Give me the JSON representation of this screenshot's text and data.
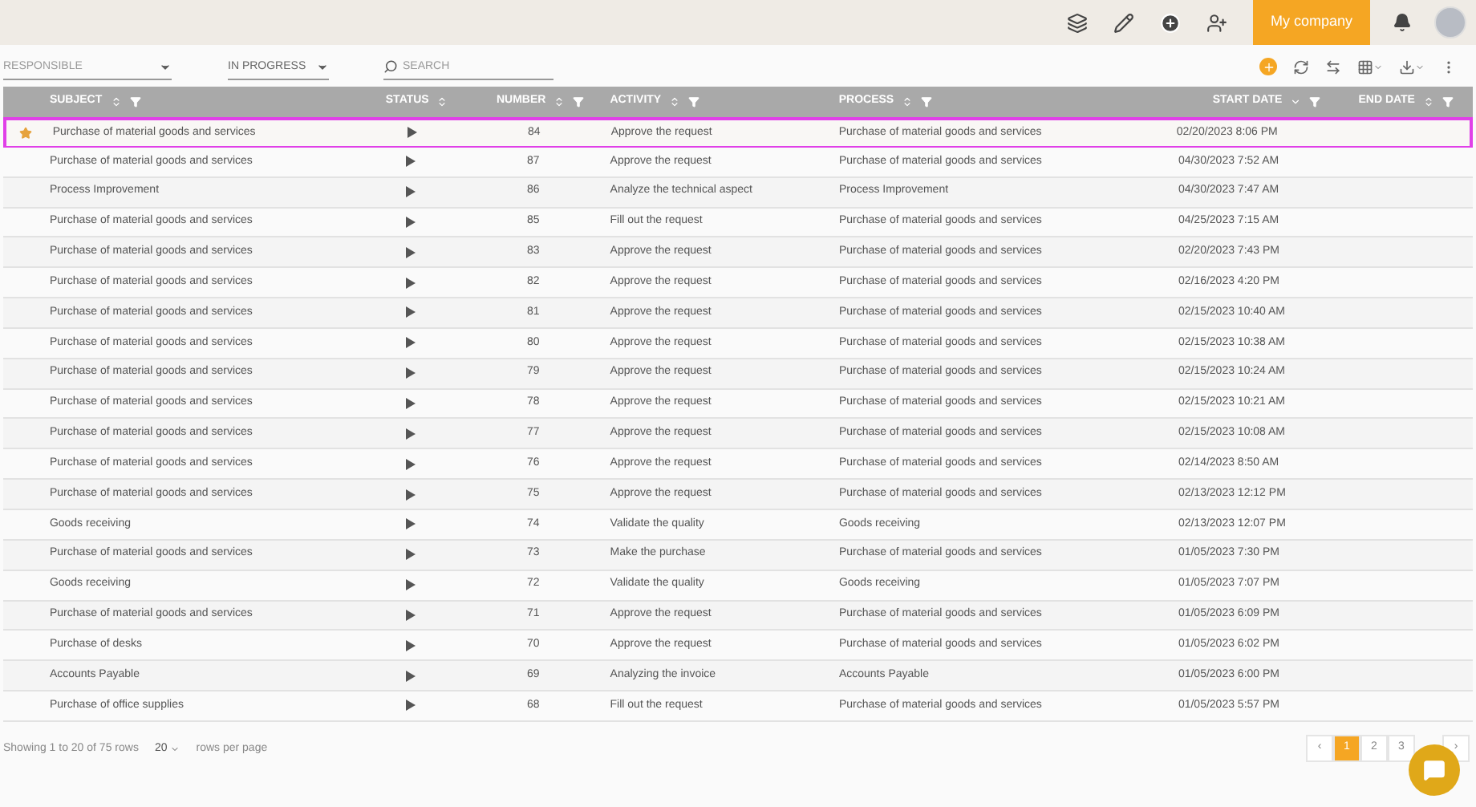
{
  "top_bar": {
    "company_button": "My company"
  },
  "filters": [
    {
      "placeholder": "RESPONSIBLE",
      "kind": "select"
    },
    {
      "value": "IN PROGRESS",
      "kind": "select"
    },
    {
      "placeholder": "SEARCH",
      "kind": "search"
    }
  ],
  "table": {
    "columns": [
      {
        "label": "SUBJECT",
        "sorted": false,
        "filter": true
      },
      {
        "label": "STATUS",
        "sorted": false,
        "filter": false
      },
      {
        "label": "NUMBER",
        "sorted": false,
        "filter": true
      },
      {
        "label": "ACTIVITY",
        "sorted": false,
        "filter": true
      },
      {
        "label": "PROCESS",
        "sorted": false,
        "filter": true
      },
      {
        "label": "START DATE",
        "sorted": true,
        "filter": true
      },
      {
        "label": "END DATE",
        "sorted": false,
        "filter": true
      }
    ],
    "rows": [
      {
        "starred": true,
        "selected": true,
        "subject": "Purchase of material goods and services",
        "number": "84",
        "activity": "Approve the request",
        "process": "Purchase of material goods and services",
        "start_date": "02/20/2023 8:06 PM"
      },
      {
        "starred": false,
        "selected": false,
        "subject": "Purchase of material goods and services",
        "number": "87",
        "activity": "Approve the request",
        "process": "Purchase of material goods and services",
        "start_date": "04/30/2023 7:52 AM"
      },
      {
        "starred": false,
        "selected": false,
        "subject": "Process Improvement",
        "number": "86",
        "activity": "Analyze the technical aspect",
        "process": "Process Improvement",
        "start_date": "04/30/2023 7:47 AM"
      },
      {
        "starred": false,
        "selected": false,
        "subject": "Purchase of material goods and services",
        "number": "85",
        "activity": "Fill out the request",
        "process": "Purchase of material goods and services",
        "start_date": "04/25/2023 7:15 AM"
      },
      {
        "starred": false,
        "selected": false,
        "subject": "Purchase of material goods and services",
        "number": "83",
        "activity": "Approve the request",
        "process": "Purchase of material goods and services",
        "start_date": "02/20/2023 7:43 PM"
      },
      {
        "starred": false,
        "selected": false,
        "subject": "Purchase of material goods and services",
        "number": "82",
        "activity": "Approve the request",
        "process": "Purchase of material goods and services",
        "start_date": "02/16/2023 4:20 PM"
      },
      {
        "starred": false,
        "selected": false,
        "subject": "Purchase of material goods and services",
        "number": "81",
        "activity": "Approve the request",
        "process": "Purchase of material goods and services",
        "start_date": "02/15/2023 10:40 AM"
      },
      {
        "starred": false,
        "selected": false,
        "subject": "Purchase of material goods and services",
        "number": "80",
        "activity": "Approve the request",
        "process": "Purchase of material goods and services",
        "start_date": "02/15/2023 10:38 AM"
      },
      {
        "starred": false,
        "selected": false,
        "subject": "Purchase of material goods and services",
        "number": "79",
        "activity": "Approve the request",
        "process": "Purchase of material goods and services",
        "start_date": "02/15/2023 10:24 AM"
      },
      {
        "starred": false,
        "selected": false,
        "subject": "Purchase of material goods and services",
        "number": "78",
        "activity": "Approve the request",
        "process": "Purchase of material goods and services",
        "start_date": "02/15/2023 10:21 AM"
      },
      {
        "starred": false,
        "selected": false,
        "subject": "Purchase of material goods and services",
        "number": "77",
        "activity": "Approve the request",
        "process": "Purchase of material goods and services",
        "start_date": "02/15/2023 10:08 AM"
      },
      {
        "starred": false,
        "selected": false,
        "subject": "Purchase of material goods and services",
        "number": "76",
        "activity": "Approve the request",
        "process": "Purchase of material goods and services",
        "start_date": "02/14/2023 8:50 AM"
      },
      {
        "starred": false,
        "selected": false,
        "subject": "Purchase of material goods and services",
        "number": "75",
        "activity": "Approve the request",
        "process": "Purchase of material goods and services",
        "start_date": "02/13/2023 12:12 PM"
      },
      {
        "starred": false,
        "selected": false,
        "subject": "Goods receiving",
        "number": "74",
        "activity": "Validate the quality",
        "process": "Goods receiving",
        "start_date": "02/13/2023 12:07 PM"
      },
      {
        "starred": false,
        "selected": false,
        "subject": "Purchase of material goods and services",
        "number": "73",
        "activity": "Make the purchase",
        "process": "Purchase of material goods and services",
        "start_date": "01/05/2023 7:30 PM"
      },
      {
        "starred": false,
        "selected": false,
        "subject": "Goods receiving",
        "number": "72",
        "activity": "Validate the quality",
        "process": "Goods receiving",
        "start_date": "01/05/2023 7:07 PM"
      },
      {
        "starred": false,
        "selected": false,
        "subject": "Purchase of material goods and services",
        "number": "71",
        "activity": "Approve the request",
        "process": "Purchase of material goods and services",
        "start_date": "01/05/2023 6:09 PM"
      },
      {
        "starred": false,
        "selected": false,
        "subject": "Purchase of desks",
        "number": "70",
        "activity": "Approve the request",
        "process": "Purchase of material goods and services",
        "start_date": "01/05/2023 6:02 PM"
      },
      {
        "starred": false,
        "selected": false,
        "subject": "Accounts Payable",
        "number": "69",
        "activity": "Analyzing the invoice",
        "process": "Accounts Payable",
        "start_date": "01/05/2023 6:00 PM"
      },
      {
        "starred": false,
        "selected": false,
        "subject": "Purchase of office supplies",
        "number": "68",
        "activity": "Fill out the request",
        "process": "Purchase of material goods and services",
        "start_date": "01/05/2023 5:57 PM"
      }
    ]
  },
  "footer": {
    "summary": "Showing 1 to 20 of 75 rows",
    "page_size": "20",
    "page_size_label": "rows per page"
  },
  "pagination": [
    {
      "label": "‹",
      "selected": false
    },
    {
      "label": "1",
      "selected": true
    },
    {
      "label": "2",
      "selected": false
    },
    {
      "label": "3",
      "selected": false
    },
    {
      "label": "›",
      "selected": false
    }
  ]
}
